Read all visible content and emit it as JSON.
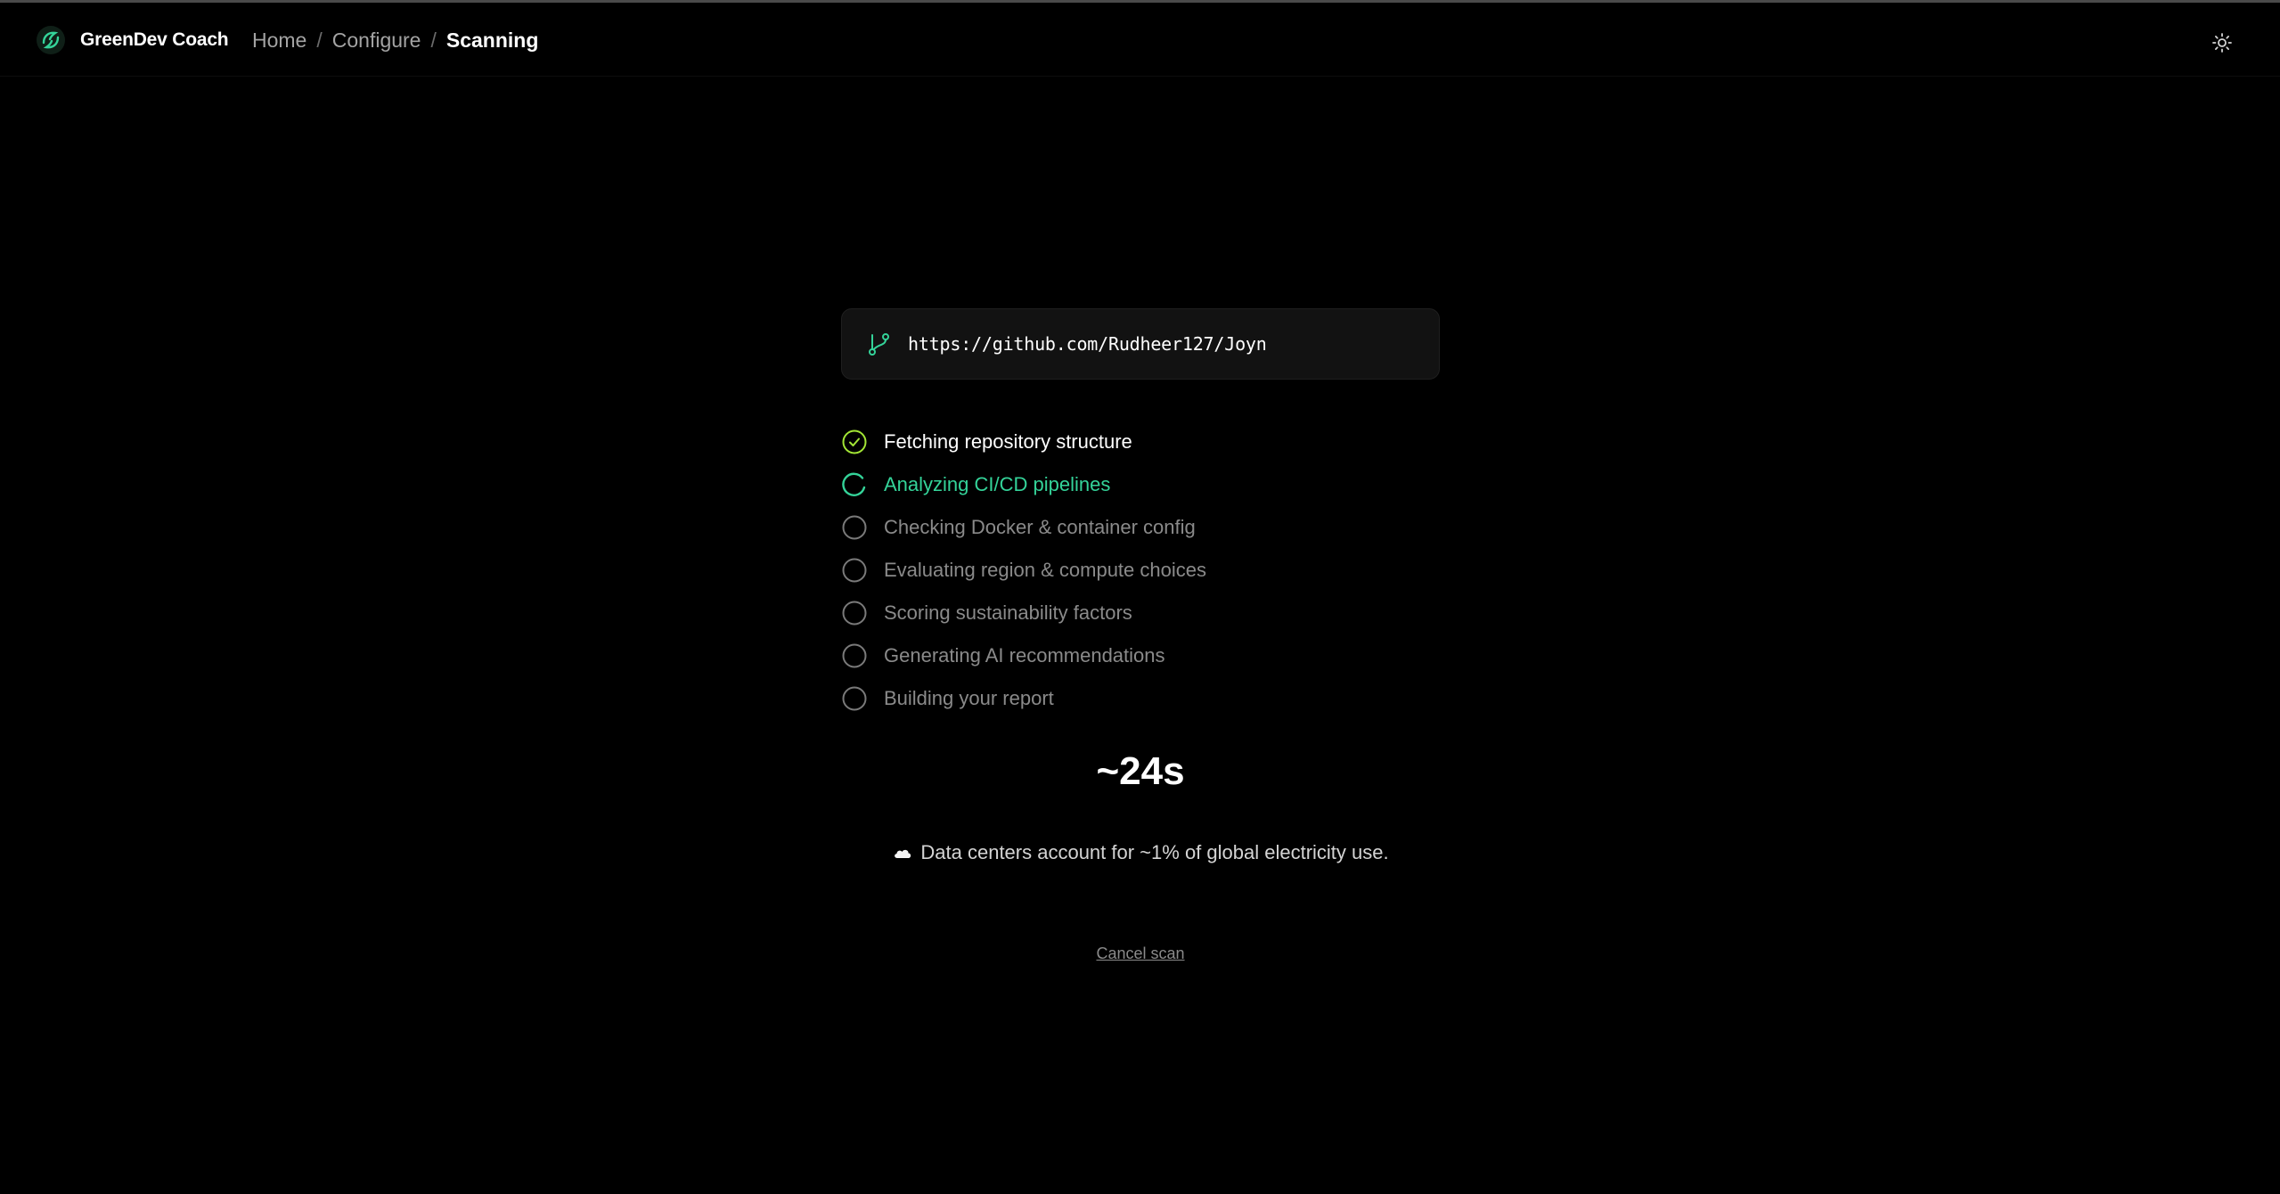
{
  "app": {
    "name": "GreenDev Coach",
    "accent_color": "#34d399"
  },
  "breadcrumb": {
    "items": [
      "Home",
      "Configure",
      "Scanning"
    ],
    "separator": "/"
  },
  "header": {
    "theme_toggle_icon": "sun-icon"
  },
  "repo": {
    "icon": "git-branch-icon",
    "url": "https://github.com/Rudheer127/Joyn"
  },
  "steps": [
    {
      "label": "Fetching repository structure",
      "status": "done",
      "icon": "check-circle-icon"
    },
    {
      "label": "Analyzing CI/CD pipelines",
      "status": "active",
      "icon": "spinner-icon"
    },
    {
      "label": "Checking Docker & container config",
      "status": "pending",
      "icon": "empty-circle-icon"
    },
    {
      "label": "Evaluating region & compute choices",
      "status": "pending",
      "icon": "empty-circle-icon"
    },
    {
      "label": "Scoring sustainability factors",
      "status": "pending",
      "icon": "empty-circle-icon"
    },
    {
      "label": "Generating AI recommendations",
      "status": "pending",
      "icon": "empty-circle-icon"
    },
    {
      "label": "Building your report",
      "status": "pending",
      "icon": "empty-circle-icon"
    }
  ],
  "timer": {
    "remaining": "~24s"
  },
  "fact": {
    "icon": "cloud-icon",
    "text": "Data centers account for ~1% of global electricity use."
  },
  "actions": {
    "cancel_label": "Cancel scan"
  }
}
